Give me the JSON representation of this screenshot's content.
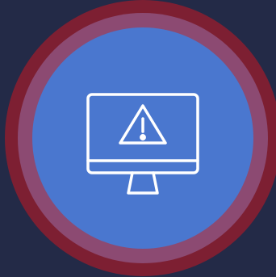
{
  "colors": {
    "background": "#232a47",
    "outer_ring": "#7d1f32",
    "middle_ring": "#8c4a72",
    "inner_disc": "#4a77cf",
    "icon_stroke": "#ffffff"
  },
  "icons": {
    "main": "computer-monitor-warning-icon",
    "symbol": "warning-triangle-icon"
  }
}
